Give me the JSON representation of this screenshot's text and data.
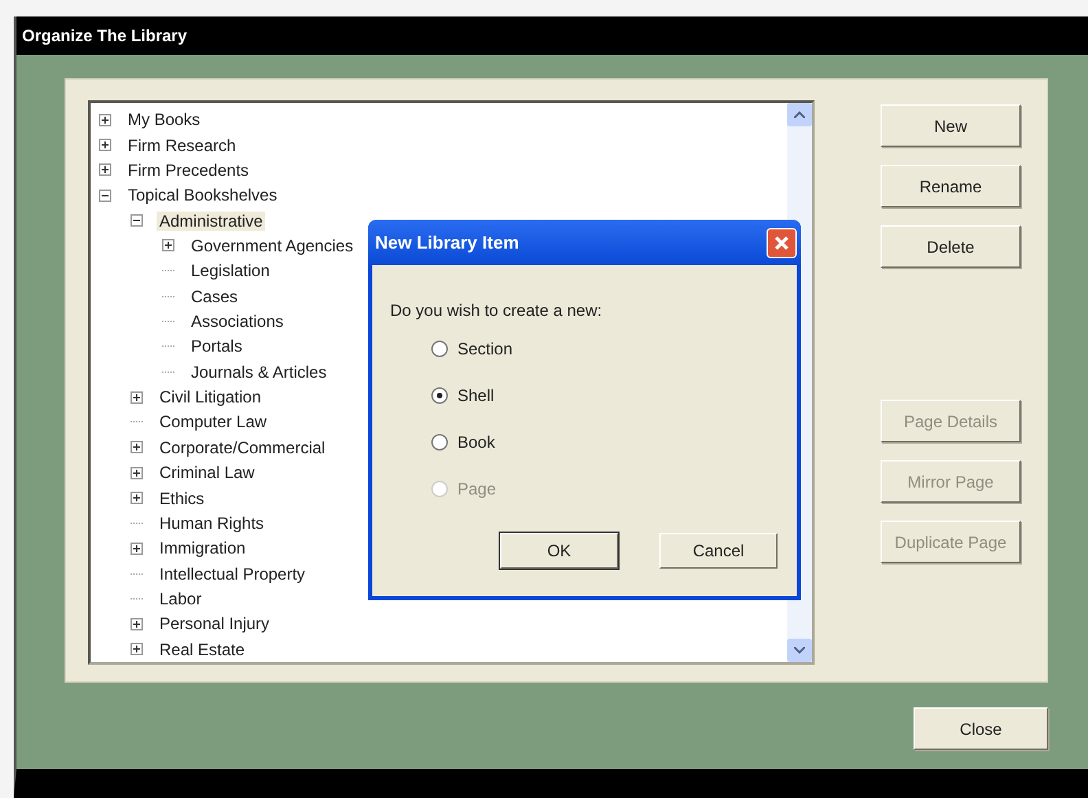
{
  "window": {
    "title": "Organize The Library"
  },
  "tree": [
    {
      "label": "My Books",
      "kind": "node",
      "expanded": false,
      "selected": false
    },
    {
      "label": "Firm Research",
      "kind": "node",
      "expanded": false,
      "selected": false
    },
    {
      "label": "Firm Precedents",
      "kind": "node",
      "expanded": false,
      "selected": false
    },
    {
      "label": "Topical Bookshelves",
      "kind": "node",
      "expanded": true,
      "selected": false,
      "children": [
        {
          "label": "Administrative",
          "kind": "node",
          "expanded": true,
          "selected": true,
          "children": [
            {
              "label": "Government Agencies",
              "kind": "node",
              "expanded": false,
              "selected": false
            },
            {
              "label": "Legislation",
              "kind": "leaf",
              "selected": false
            },
            {
              "label": "Cases",
              "kind": "leaf",
              "selected": false
            },
            {
              "label": "Associations",
              "kind": "leaf",
              "selected": false
            },
            {
              "label": "Portals",
              "kind": "leaf",
              "selected": false
            },
            {
              "label": "Journals & Articles",
              "kind": "leaf",
              "selected": false
            }
          ]
        },
        {
          "label": "Civil Litigation",
          "kind": "node",
          "expanded": false,
          "selected": false
        },
        {
          "label": "Computer Law",
          "kind": "leaf",
          "selected": false
        },
        {
          "label": "Corporate/Commercial",
          "kind": "node",
          "expanded": false,
          "selected": false
        },
        {
          "label": "Criminal Law",
          "kind": "node",
          "expanded": false,
          "selected": false
        },
        {
          "label": "Ethics",
          "kind": "node",
          "expanded": false,
          "selected": false
        },
        {
          "label": "Human Rights",
          "kind": "leaf",
          "selected": false
        },
        {
          "label": "Immigration",
          "kind": "node",
          "expanded": false,
          "selected": false
        },
        {
          "label": "Intellectual Property",
          "kind": "leaf",
          "selected": false
        },
        {
          "label": "Labor",
          "kind": "leaf",
          "selected": false
        },
        {
          "label": "Personal Injury",
          "kind": "node",
          "expanded": false,
          "selected": false
        },
        {
          "label": "Real Estate",
          "kind": "node",
          "expanded": false,
          "selected": false
        }
      ]
    }
  ],
  "side_buttons": [
    {
      "label": "New",
      "disabled": false
    },
    {
      "label": "Rename",
      "disabled": false
    },
    {
      "label": "Delete",
      "disabled": false
    },
    {
      "label": "Page Details",
      "disabled": true
    },
    {
      "label": "Mirror Page",
      "disabled": true
    },
    {
      "label": "Duplicate Page",
      "disabled": true
    }
  ],
  "close_button": "Close",
  "dialog": {
    "title": "New Library Item",
    "prompt": "Do you wish to create a new:",
    "options": [
      {
        "label": "Section",
        "selected": false,
        "disabled": false
      },
      {
        "label": "Shell",
        "selected": true,
        "disabled": false
      },
      {
        "label": "Book",
        "selected": false,
        "disabled": false
      },
      {
        "label": "Page",
        "selected": false,
        "disabled": true
      }
    ],
    "buttons": [
      "OK",
      "Cancel"
    ]
  }
}
